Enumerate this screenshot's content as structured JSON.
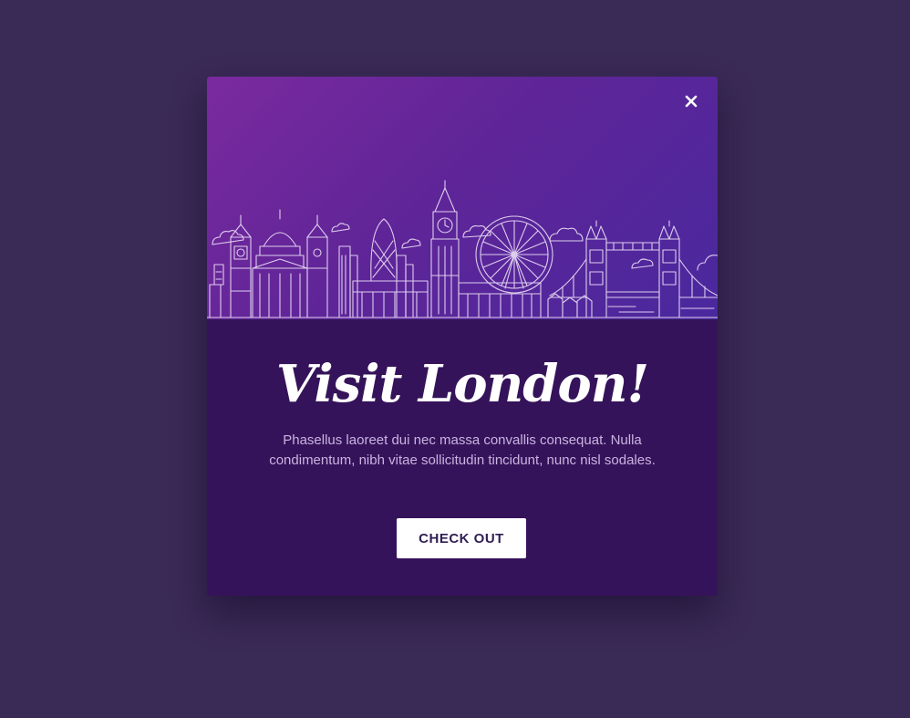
{
  "popup": {
    "title": "Visit London!",
    "description": "Phasellus laoreet dui nec massa convallis consequat. Nulla condimentum, nibh vitae sollicitudin tincidunt, nunc nisl sodales.",
    "cta_label": "CHECK OUT",
    "close_icon": "close-icon",
    "hero_illustration": "london-skyline-illustration"
  },
  "colors": {
    "page_background": "#3a2a56",
    "modal_background": "#35135a",
    "hero_gradient_start": "#7a2a9e",
    "hero_gradient_end": "#4a289e",
    "title_text": "#ffffff",
    "description_text": "#c9b3e0",
    "button_background": "#ffffff",
    "button_text": "#2f1e52"
  }
}
